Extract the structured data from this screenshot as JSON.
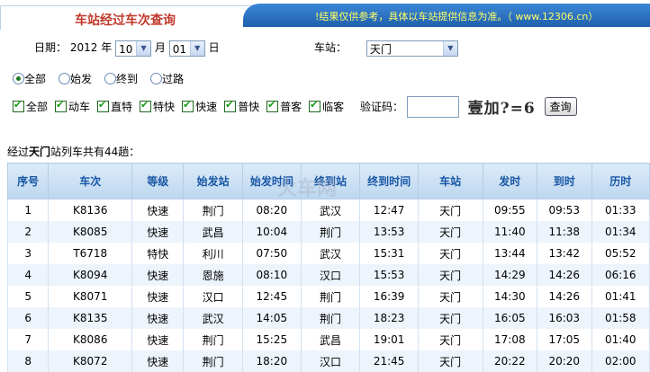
{
  "header": {
    "title": "车站经过车次查询",
    "notice": "!结果仅供参考，具体以车站提供信息为准。（ www.12306.cn）"
  },
  "form": {
    "date_label": "日期：",
    "year": "2012",
    "year_unit": "年",
    "month": "10",
    "month_unit": "月",
    "day": "01",
    "day_unit": "日",
    "station_label": "车站：",
    "station": "天门",
    "radios": [
      {
        "label": "全部",
        "checked": true
      },
      {
        "label": "始发",
        "checked": false
      },
      {
        "label": "终到",
        "checked": false
      },
      {
        "label": "过路",
        "checked": false
      }
    ],
    "checkboxes": [
      "全部",
      "动车",
      "直特",
      "特快",
      "快速",
      "普快",
      "普客",
      "临客"
    ],
    "captcha_label": "验证码：",
    "captcha_text": "壹加?=6",
    "query_button": "查询"
  },
  "summary": {
    "prefix": "经过",
    "station": "天门",
    "suffix": "站列车共有44趟："
  },
  "watermark": "火车网",
  "table": {
    "headers": [
      "序号",
      "车次",
      "等级",
      "始发站",
      "始发时间",
      "终到站",
      "终到时间",
      "车站",
      "发时",
      "到时",
      "历时"
    ],
    "rows": [
      [
        "1",
        "K8136",
        "快速",
        "荆门",
        "08:20",
        "武汉",
        "12:47",
        "天门",
        "09:55",
        "09:53",
        "01:33"
      ],
      [
        "2",
        "K8085",
        "快速",
        "武昌",
        "10:04",
        "荆门",
        "13:53",
        "天门",
        "11:40",
        "11:38",
        "01:34"
      ],
      [
        "3",
        "T6718",
        "特快",
        "利川",
        "07:50",
        "武汉",
        "15:31",
        "天门",
        "13:44",
        "13:42",
        "05:52"
      ],
      [
        "4",
        "K8094",
        "快速",
        "恩施",
        "08:10",
        "汉口",
        "15:53",
        "天门",
        "14:29",
        "14:26",
        "06:16"
      ],
      [
        "5",
        "K8071",
        "快速",
        "汉口",
        "12:45",
        "荆门",
        "16:39",
        "天门",
        "14:30",
        "14:26",
        "01:41"
      ],
      [
        "6",
        "K8135",
        "快速",
        "武汉",
        "14:05",
        "荆门",
        "18:23",
        "天门",
        "16:05",
        "16:03",
        "01:58"
      ],
      [
        "7",
        "K8086",
        "快速",
        "荆门",
        "15:25",
        "武昌",
        "19:01",
        "天门",
        "17:08",
        "17:05",
        "01:40"
      ],
      [
        "8",
        "K8072",
        "快速",
        "荆门",
        "18:20",
        "汉口",
        "21:45",
        "天门",
        "20:22",
        "20:20",
        "02:00"
      ]
    ]
  }
}
